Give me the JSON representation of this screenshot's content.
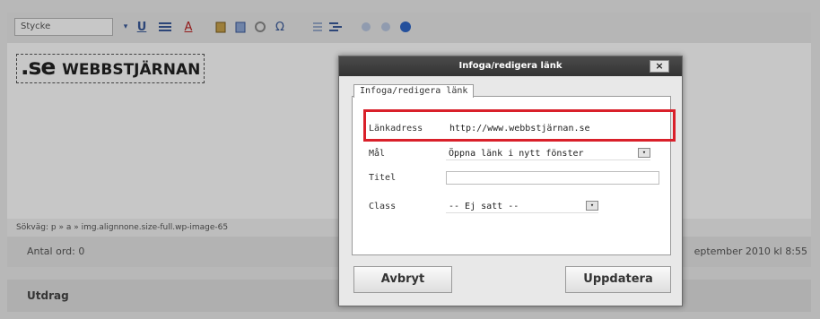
{
  "editor": {
    "style_select": "Stycke",
    "toolbar_icons": [
      "underline-icon",
      "justify-icon",
      "text-color-icon",
      "paste-text-icon",
      "paste-word-icon",
      "clear-format-icon",
      "omega-icon",
      "outdent-icon",
      "indent-icon",
      "undo-icon",
      "redo-icon",
      "help-icon"
    ],
    "glyph_underline": "U",
    "glyph_color": "A",
    "glyph_omega": "Ω",
    "glyph_dropdown": "▾",
    "content_logo_prefix": ".se",
    "content_logo_brand": "WEBBSTJÄRNAN",
    "path": "Sökväg: p » a » img.alignnone.size-full.wp-image-65",
    "word_count": "Antal ord: 0",
    "last_edit": "eptember 2010 kl 8:55",
    "excerpt_heading": "Utdrag"
  },
  "dialog": {
    "title": "Infoga/redigera länk",
    "close": "×",
    "tab": "Infoga/redigera länk",
    "fields": {
      "url_label": "Länkadress",
      "url_value": "http://www.webbstjärnan.se",
      "target_label": "Mål",
      "target_value": "Öppna länk i nytt fönster",
      "title_label": "Titel",
      "title_value": "",
      "class_label": "Class",
      "class_value": "-- Ej satt --"
    },
    "cancel": "Avbryt",
    "update": "Uppdatera"
  },
  "colors": {
    "highlight": "#d9202a",
    "titlebar": "#3a3a3a"
  }
}
